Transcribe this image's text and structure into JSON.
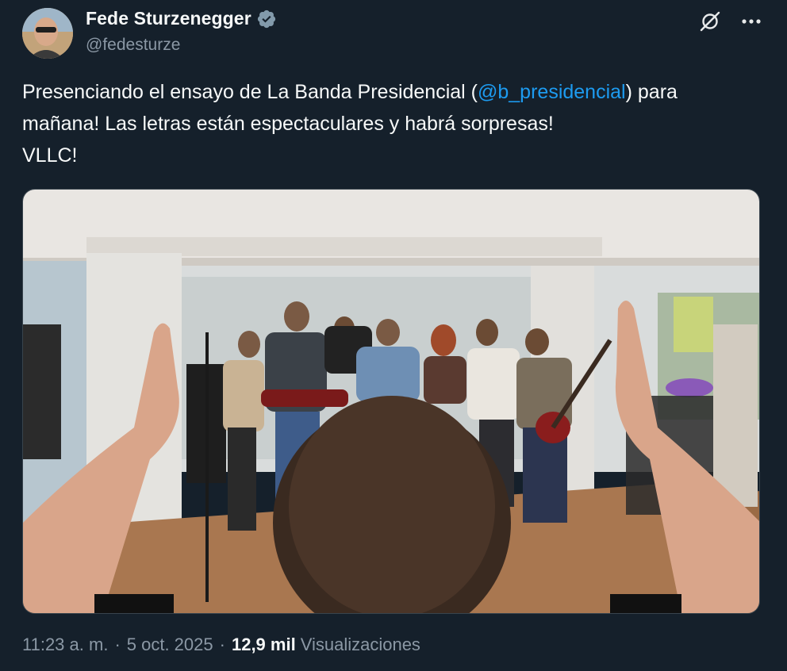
{
  "author": {
    "display_name": "Fede Sturzenegger",
    "handle": "@fedesturze",
    "verified": true,
    "avatar_icon": "profile-photo"
  },
  "actions": {
    "grok_icon": "grok-icon",
    "more_icon": "more-icon"
  },
  "tweet": {
    "line1_before": "Presenciando el ensayo de La Banda Presidencial (",
    "mention": "@b_presidencial",
    "line1_after": ") para",
    "line2": "mañana! Las letras están espectaculares y habrá sorpresas!",
    "line3": "VLLC!"
  },
  "media": {
    "type": "photo"
  },
  "meta": {
    "time": "11:23 a. m.",
    "separator": "·",
    "date": "5 oct. 2025",
    "views_count": "12,9 mil",
    "views_label": "Visualizaciones"
  },
  "colors": {
    "background": "#15202b",
    "text": "#f7f9f9",
    "secondary": "#8b98a5",
    "link": "#1d9bf0",
    "verified": "#829aab"
  }
}
